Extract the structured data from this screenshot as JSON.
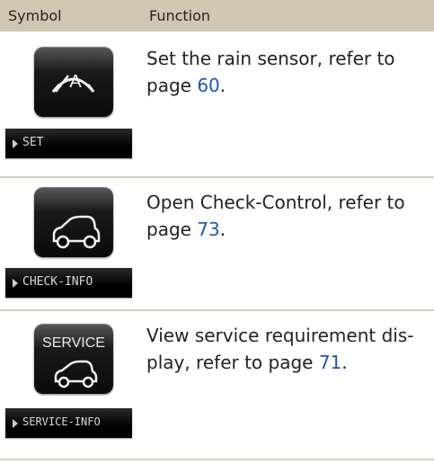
{
  "table": {
    "headers": {
      "symbol": "Symbol",
      "function": "Function"
    },
    "rows": [
      {
        "icon": "wiper-rain-sensor-icon",
        "bar_label": "SET",
        "text_before": "Set the rain sensor, refer to page ",
        "page": "60",
        "text_after": "."
      },
      {
        "icon": "car-check-control-icon",
        "bar_label": "CHECK-INFO",
        "text_before": "Open Check-Control, refer to page ",
        "page": "73",
        "text_after": "."
      },
      {
        "icon": "service-car-icon",
        "icon_label": "SERVICE",
        "bar_label": "SERVICE-INFO",
        "text_before": "View service requirement dis-play, refer to page ",
        "page": "71",
        "text_after": "."
      }
    ]
  },
  "colors": {
    "header_bg": "#cfc7b2",
    "link": "#1a55c2",
    "separator": "#d4cfc1"
  }
}
